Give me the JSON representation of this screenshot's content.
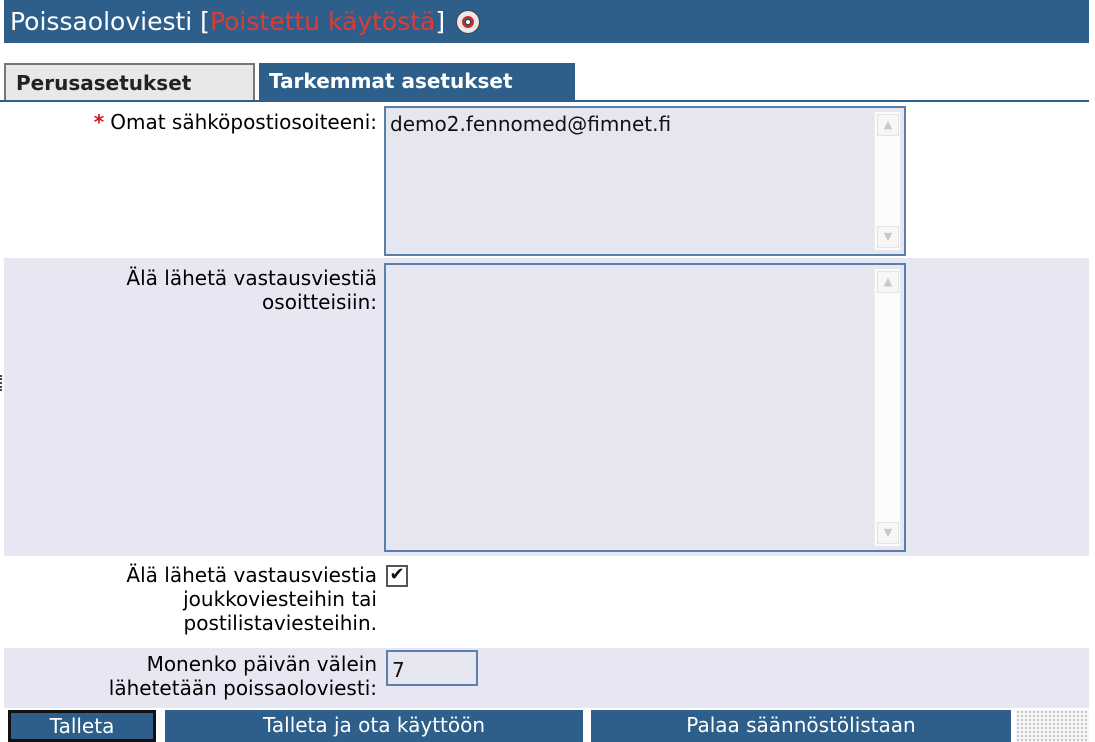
{
  "window": {
    "title": "Poissaoloviesti",
    "bracket_open": " [",
    "status": "Poistettu käytöstä",
    "bracket_close": "] ",
    "help_icon": "lifebuoy-icon"
  },
  "tabs": [
    {
      "label": "Perusasetukset",
      "active": true
    },
    {
      "label": "Tarkemmat asetukset",
      "active": false
    }
  ],
  "form": {
    "own_emails": {
      "required_mark": "*",
      "label": "Omat sähköpostiosoiteeni:",
      "value": "demo2.fennomed@fimnet.fi"
    },
    "no_reply_addresses": {
      "label_line1": "Älä lähetä vastausviestiä",
      "label_line2": "osoitteisiin:",
      "value": ""
    },
    "no_reply_mass": {
      "label_line1": "Älä lähetä vastausviestia",
      "label_line2": "joukkoviesteihin tai",
      "label_line3": "postilistaviesteihin.",
      "checked": true,
      "check_glyph": "✔"
    },
    "interval_days": {
      "label_line1": "Monenko päivän välein",
      "label_line2": "lähetetään poissaoloviesti:",
      "value": "7"
    }
  },
  "buttons": {
    "save": "Talleta",
    "save_enable": "Talleta ja ota käyttöön",
    "back": "Palaa säännöstölistaan"
  },
  "colors": {
    "header": "#2e5f8a",
    "status_red": "#e23a32",
    "alt_row": "#e7e7f4",
    "field_bg": "#e6e6f0"
  }
}
